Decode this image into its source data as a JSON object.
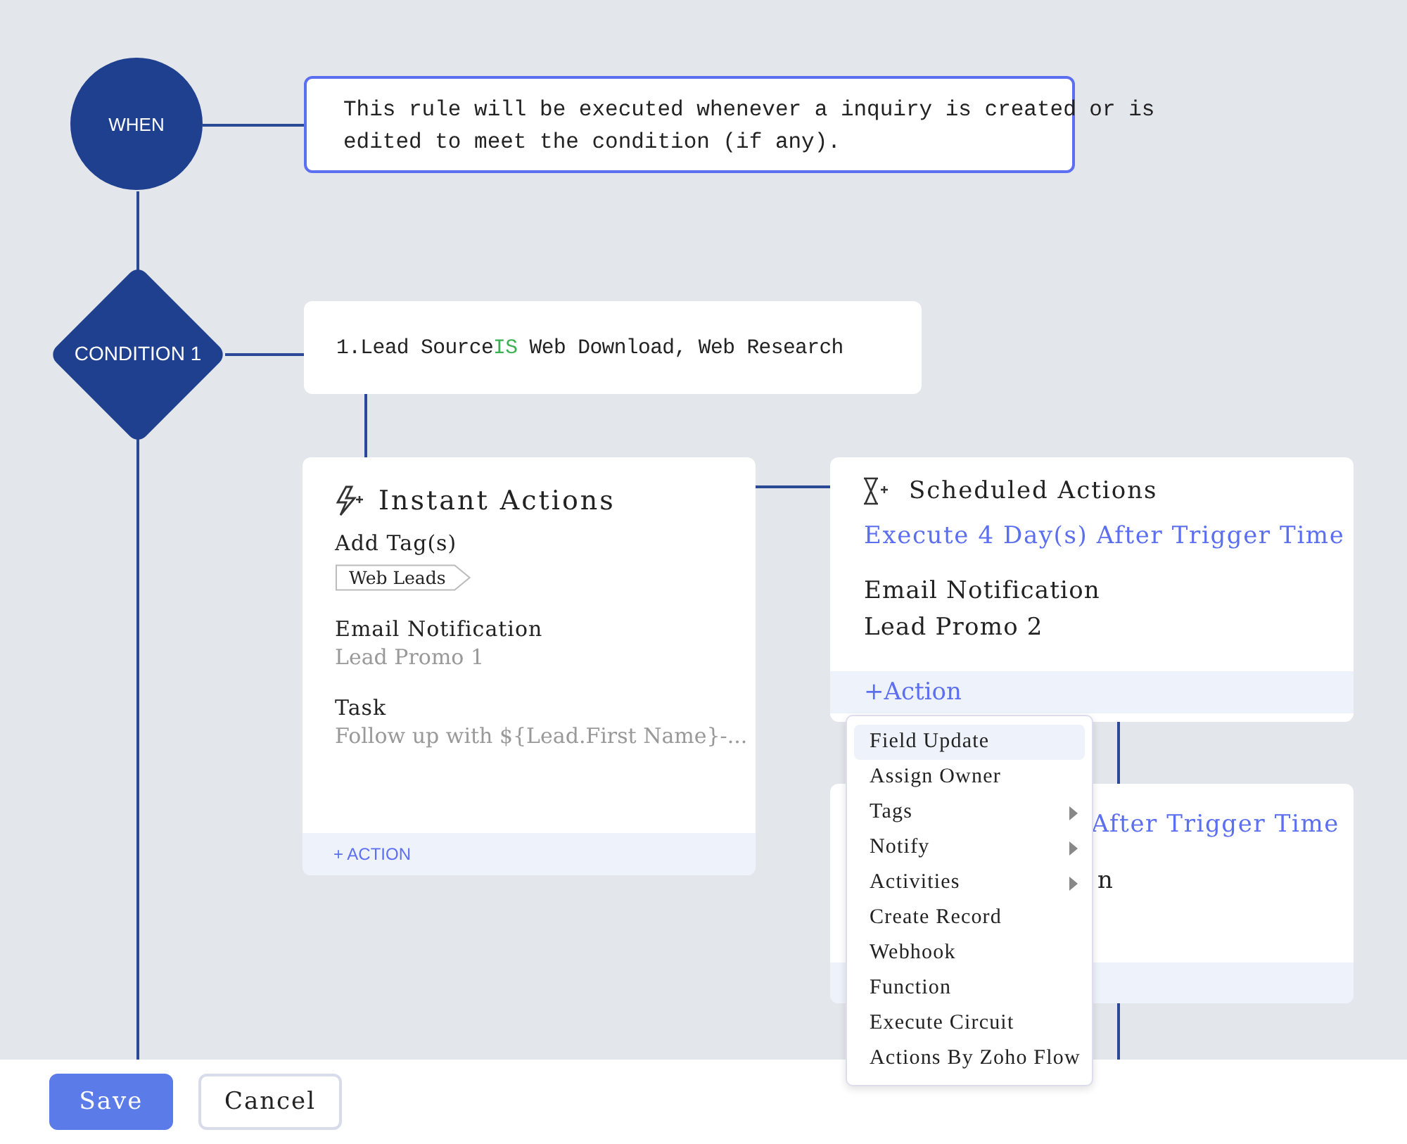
{
  "trigger": {
    "label": "WHEN",
    "description": "This rule will be executed whenever a inquiry is created or is edited to meet the condition (if any)."
  },
  "condition": {
    "label": "CONDITION 1",
    "criteria": {
      "prefix": "1.Lead Source",
      "operator": "IS",
      "value": "Web Download, Web Research"
    }
  },
  "instant_actions": {
    "title": "Instant Actions",
    "tag_heading": "Add Tag(s)",
    "tag": "Web Leads",
    "items": [
      {
        "label": "Email Notification",
        "value": "Lead Promo 1"
      },
      {
        "label": "Task",
        "value": "Follow up with ${Lead.First Name}-..."
      }
    ],
    "add_action": "+ ACTION"
  },
  "scheduled_actions": {
    "title": "Scheduled Actions",
    "schedule": "Execute 4 Day(s) After Trigger Time",
    "label": "Email Notification",
    "value": "Lead Promo 2",
    "add_action": "+Action"
  },
  "scheduled_actions_2": {
    "schedule": "After Trigger Time",
    "label": "n"
  },
  "action_menu": [
    {
      "label": "Field Update",
      "kind": "item",
      "selected": true
    },
    {
      "label": "Assign Owner",
      "kind": "item",
      "selected": false
    },
    {
      "label": "Tags",
      "kind": "submenu",
      "selected": false
    },
    {
      "label": "Notify",
      "kind": "submenu",
      "selected": false
    },
    {
      "label": "Activities",
      "kind": "submenu",
      "selected": false
    },
    {
      "label": "Create Record",
      "kind": "item",
      "selected": false
    },
    {
      "label": "Webhook",
      "kind": "item",
      "selected": false
    },
    {
      "label": "Function",
      "kind": "item",
      "selected": false
    },
    {
      "label": "Execute Circuit",
      "kind": "item",
      "selected": false
    },
    {
      "label": "Actions By Zoho Flow",
      "kind": "item",
      "selected": false
    }
  ],
  "footer": {
    "buttons": [
      "Save",
      "Cancel"
    ]
  }
}
